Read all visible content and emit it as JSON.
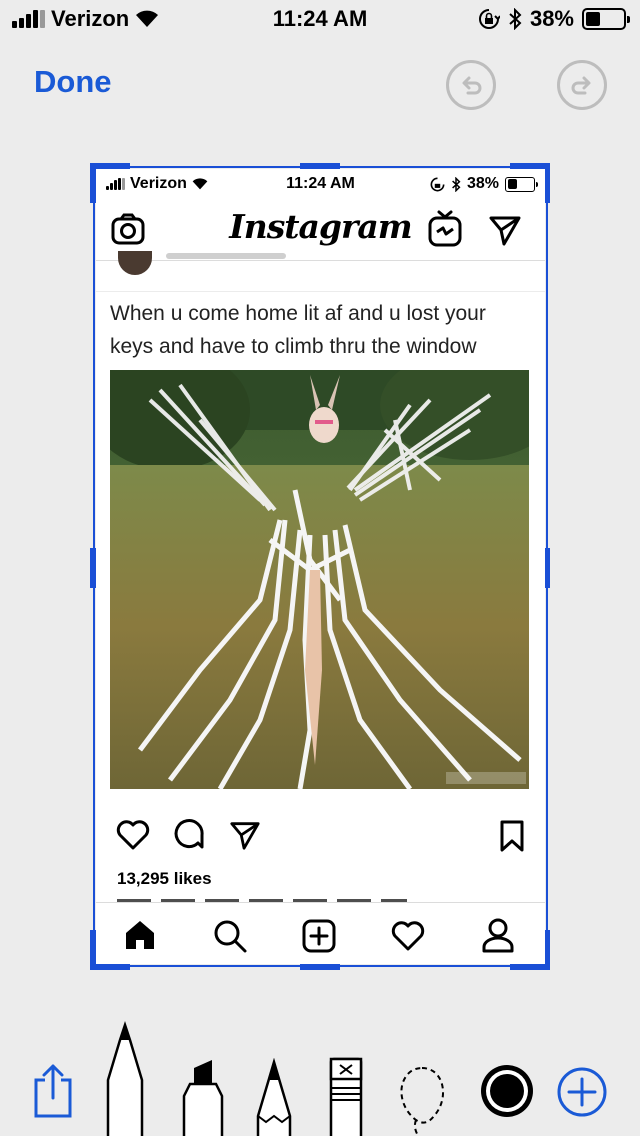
{
  "status_bar": {
    "carrier": "Verizon",
    "time": "11:24 AM",
    "battery": "38%",
    "battery_level": 0.38
  },
  "toolbar": {
    "done_label": "Done",
    "undo_icon": "undo-icon",
    "redo_icon": "redo-icon"
  },
  "screenshot": {
    "status_bar": {
      "carrier": "Verizon",
      "time": "11:24 AM",
      "battery": "38%"
    },
    "app": {
      "logo": "Instagram",
      "camera_icon": "camera-icon",
      "igtv_icon": "igtv-icon",
      "direct_icon": "paper-plane-icon"
    },
    "post": {
      "caption": "When u come home lit af and u lost your keys and have to climb thru the window",
      "likes": "13,295 likes"
    },
    "tab_bar": [
      "home-icon",
      "search-icon",
      "add-post-icon",
      "heart-icon",
      "profile-icon"
    ]
  },
  "markup_tools": {
    "share": "share-icon",
    "pen": "pen-tool",
    "marker": "marker-tool",
    "pencil": "pencil-tool",
    "eraser": "eraser-tool",
    "lasso": "lasso-tool",
    "color": "color-picker",
    "more": "add-icon",
    "accent_color": "#1a5ad6"
  }
}
